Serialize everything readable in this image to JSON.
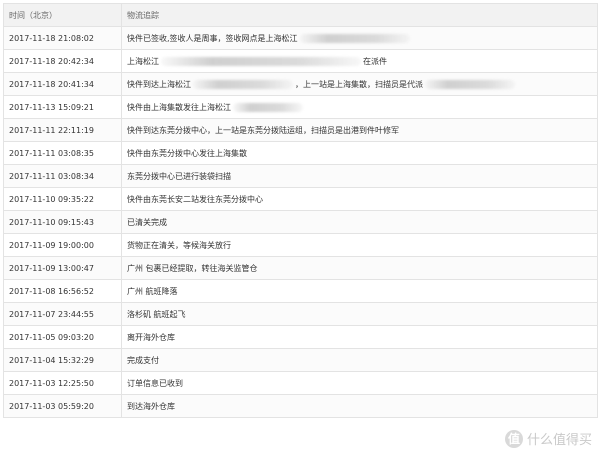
{
  "table": {
    "headers": {
      "time": "时间（北京）",
      "info": "物流追踪"
    },
    "rows": [
      {
        "time": "2017-11-18 21:08:02",
        "info": "快件已签收,签收人是周事，签收网点是上海松江",
        "redact": [
          110
        ],
        "suffix": ""
      },
      {
        "time": "2017-11-18 20:42:34",
        "info": "上海松江",
        "redact": [
          200
        ],
        "suffix": "在派件"
      },
      {
        "time": "2017-11-18 20:41:34",
        "info": "快件到达上海松江",
        "redact": [
          100
        ],
        "suffix": "，上一站是上海集散，扫描员是代派",
        "redact_after": [
          90
        ]
      },
      {
        "time": "2017-11-13 15:09:21",
        "info": "快件由上海集散发往上海松江",
        "redact": [
          70
        ],
        "suffix": ""
      },
      {
        "time": "2017-11-11 22:11:19",
        "info": "快件到达东莞分拨中心，上一站是东莞分拨陆运组，扫描员是出港到件叶修军",
        "redact": [],
        "suffix": ""
      },
      {
        "time": "2017-11-11 03:08:35",
        "info": "快件由东莞分拨中心发往上海集散",
        "redact": [],
        "suffix": ""
      },
      {
        "time": "2017-11-11 03:08:34",
        "info": "东莞分拨中心已进行装袋扫描",
        "redact": [],
        "suffix": ""
      },
      {
        "time": "2017-11-10 09:35:22",
        "info": "快件由东莞长安二站发往东莞分拨中心",
        "redact": [],
        "suffix": ""
      },
      {
        "time": "2017-11-10 09:15:43",
        "info": "已清关完成",
        "redact": [],
        "suffix": ""
      },
      {
        "time": "2017-11-09 19:00:00",
        "info": "货物正在清关，等候海关放行",
        "redact": [],
        "suffix": ""
      },
      {
        "time": "2017-11-09 13:00:47",
        "info": "广州 包裹已经提取，转往海关监管仓",
        "redact": [],
        "suffix": ""
      },
      {
        "time": "2017-11-08 16:56:52",
        "info": "广州 航班降落",
        "redact": [],
        "suffix": ""
      },
      {
        "time": "2017-11-07 23:44:55",
        "info": "洛杉矶 航班起飞",
        "redact": [],
        "suffix": ""
      },
      {
        "time": "2017-11-05 09:03:20",
        "info": "离开海外仓库",
        "redact": [],
        "suffix": ""
      },
      {
        "time": "2017-11-04 15:32:29",
        "info": "完成支付",
        "redact": [],
        "suffix": ""
      },
      {
        "time": "2017-11-03 12:25:50",
        "info": "订单信息已收到",
        "redact": [],
        "suffix": ""
      },
      {
        "time": "2017-11-03 05:59:20",
        "info": "到达海外仓库",
        "redact": [],
        "suffix": ""
      }
    ]
  },
  "watermark": {
    "logo": "值",
    "text": "什么值得买"
  },
  "colors": {
    "header_bg": "#f2f2f2",
    "border": "#e3e3e3",
    "text": "#333333",
    "watermark": "#c9c9c9"
  }
}
